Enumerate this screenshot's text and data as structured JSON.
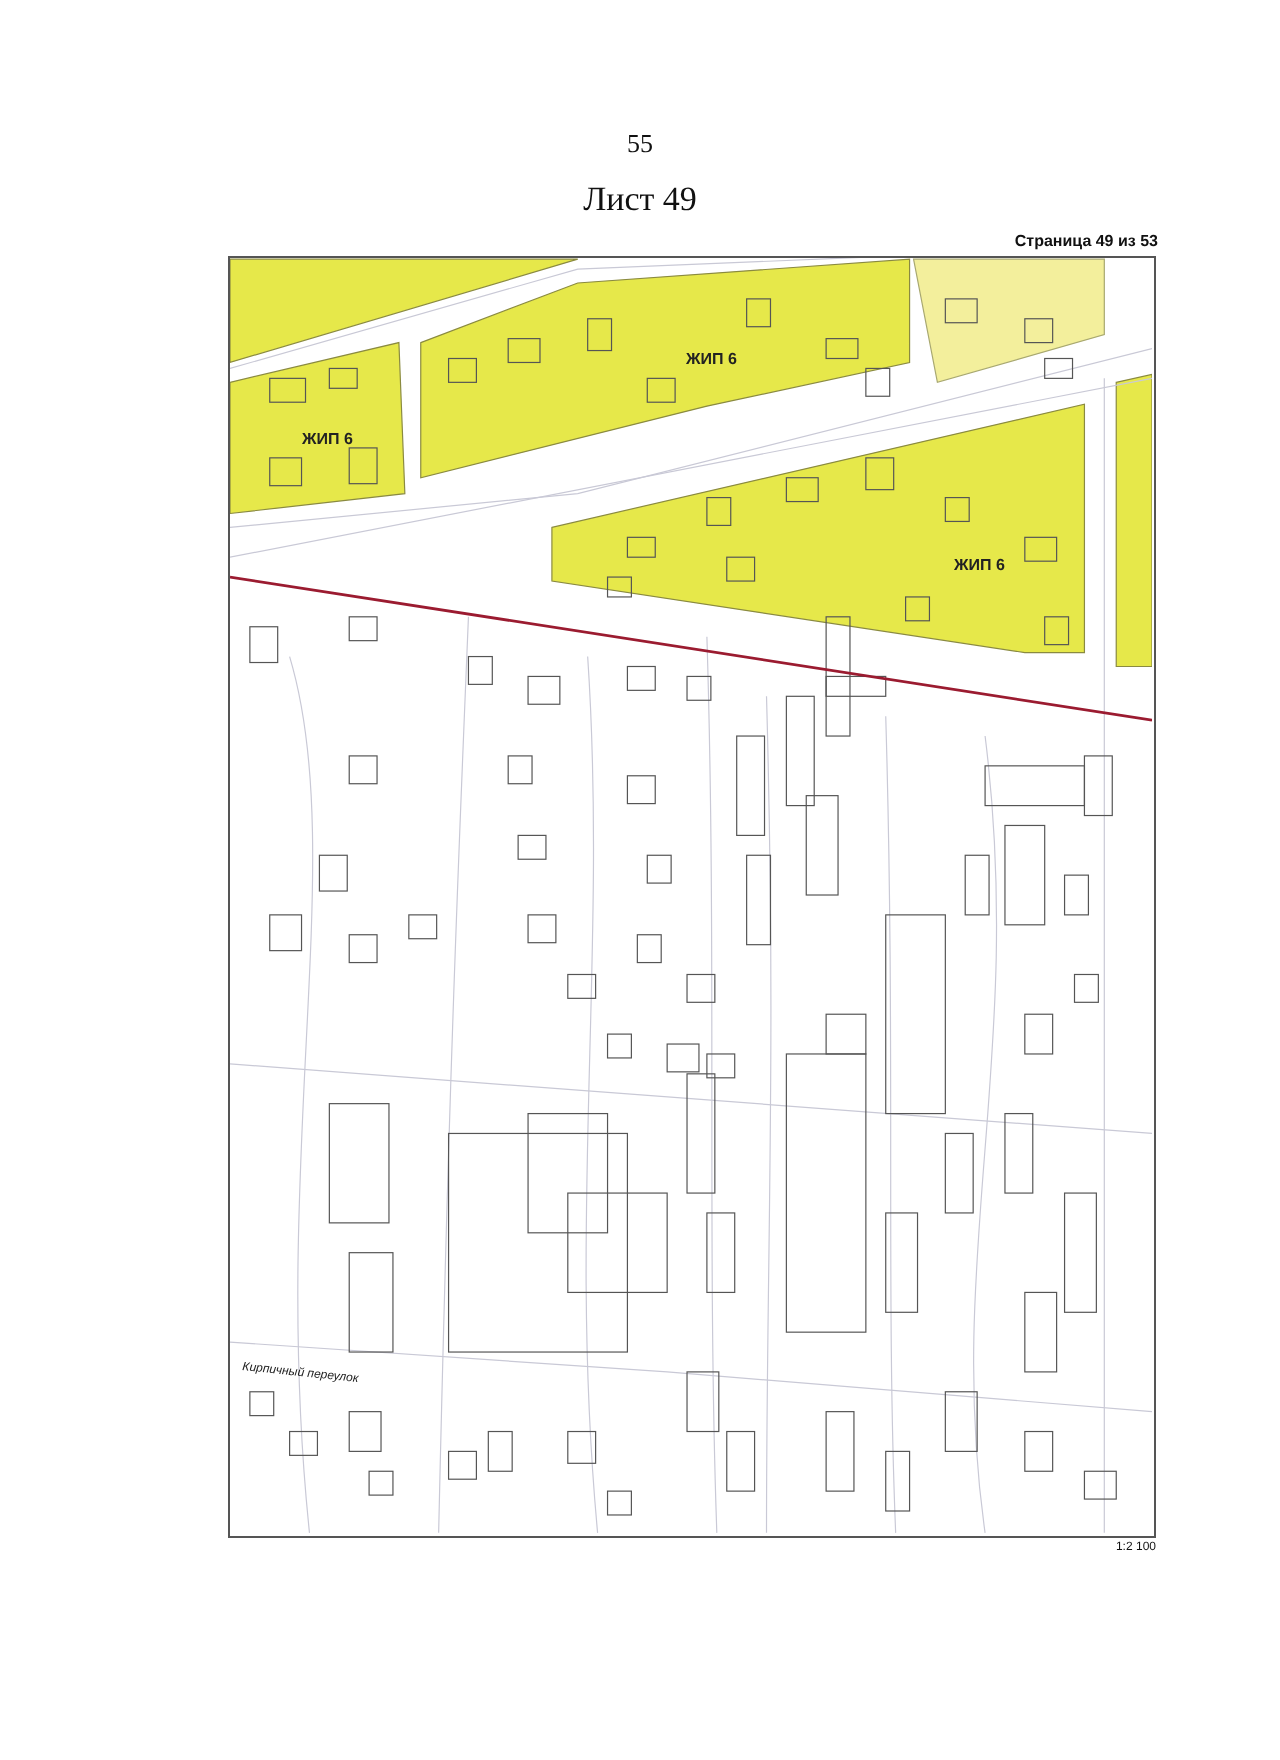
{
  "page_number": "55",
  "sheet_title": "Лист 49",
  "page_counter": "Страница 49 из 53",
  "map": {
    "labels": [
      {
        "kind": "zone",
        "text": "ЖИП 6"
      },
      {
        "kind": "zone",
        "text": "ЖИП 6"
      },
      {
        "kind": "zone",
        "text": "ЖИП 6"
      },
      {
        "kind": "street",
        "text": "Кирпичный переулок"
      }
    ]
  },
  "scale": "1:2 100"
}
